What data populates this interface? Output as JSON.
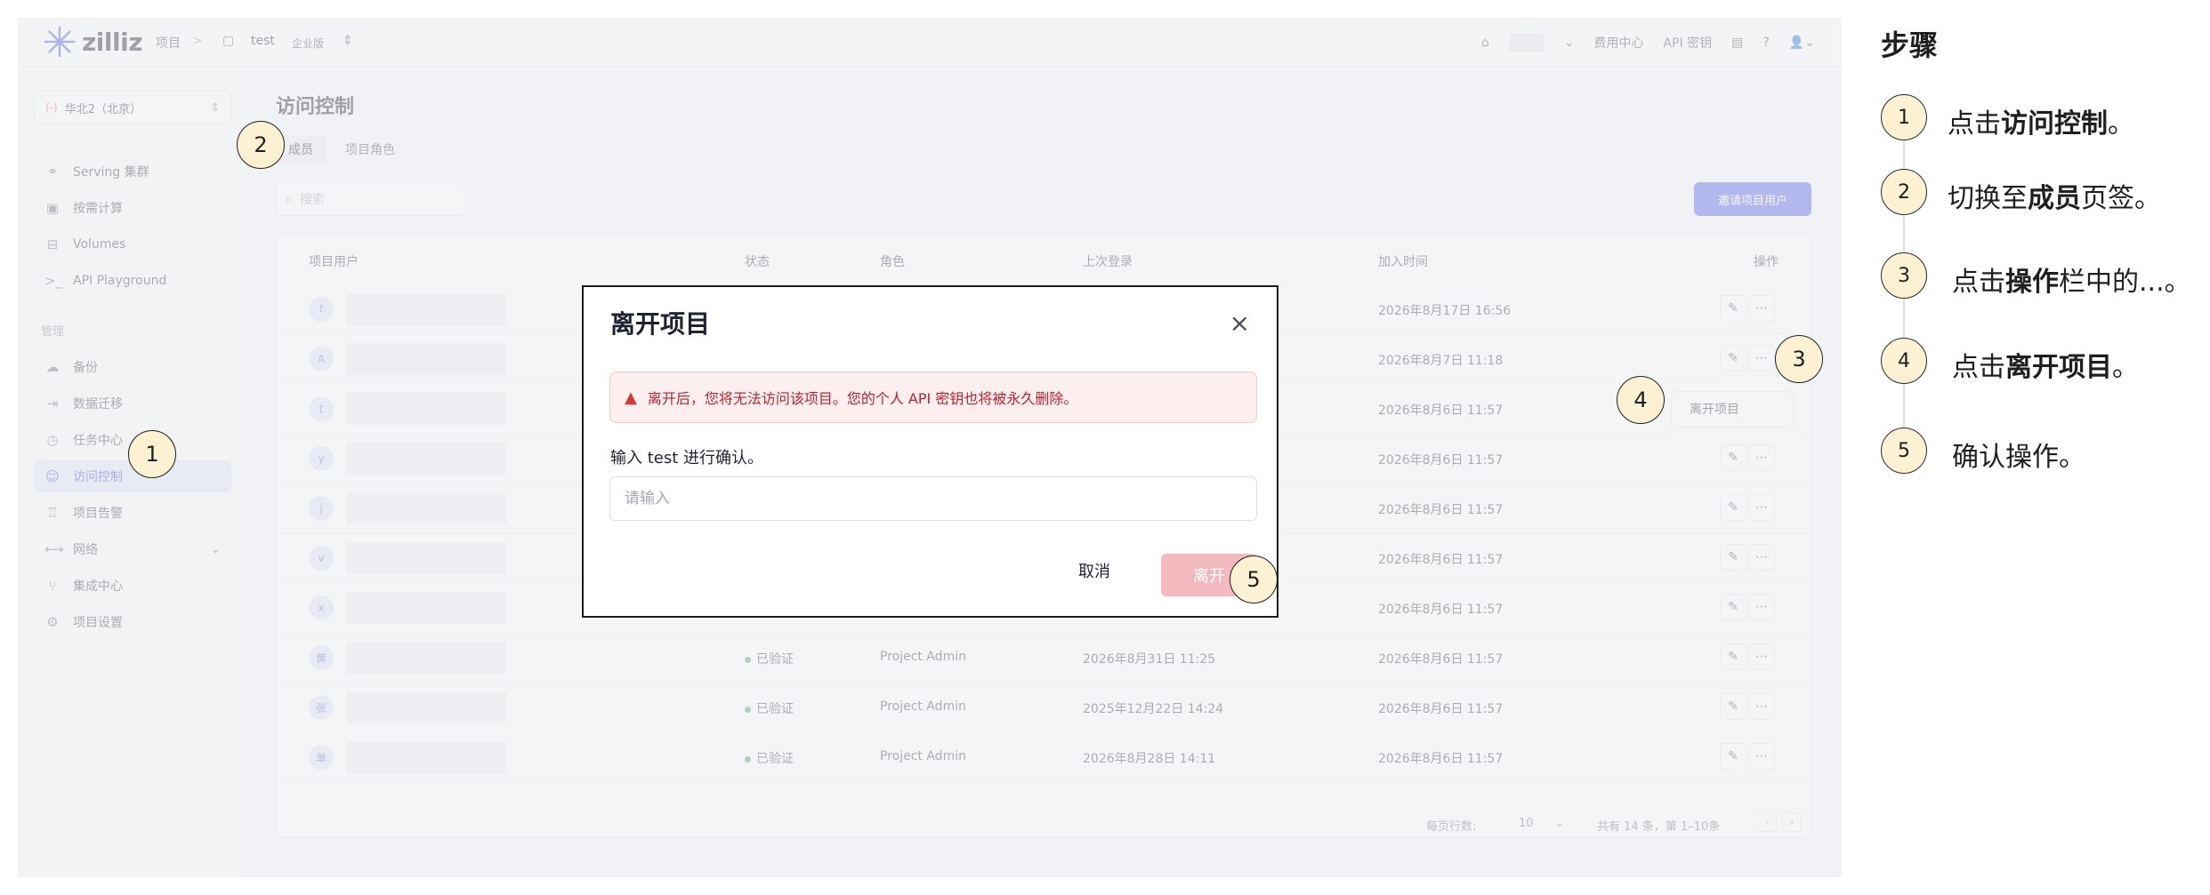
{
  "topbar": {
    "logo": "zilliz",
    "crumb_project": "项目",
    "crumb_sep": ">",
    "project_name": "test",
    "plan": "企业版",
    "billing": "费用中心",
    "api_key": "API 密钥"
  },
  "sidebar": {
    "region": "华北2（北京）",
    "region_tag": "(-)",
    "items": [
      {
        "label": "Serving 集群",
        "icon": "cluster-icon"
      },
      {
        "label": "按需计算",
        "icon": "compute-icon"
      },
      {
        "label": "Volumes",
        "icon": "volume-icon"
      },
      {
        "label": "API Playground",
        "icon": "terminal-icon"
      }
    ],
    "section": "管理",
    "manage_items": [
      {
        "label": "备份",
        "icon": "backup-icon"
      },
      {
        "label": "数据迁移",
        "icon": "migration-icon"
      },
      {
        "label": "任务中心",
        "icon": "clock-icon"
      },
      {
        "label": "访问控制",
        "icon": "users-icon"
      },
      {
        "label": "项目告警",
        "icon": "alarm-icon"
      },
      {
        "label": "网络",
        "icon": "network-icon"
      },
      {
        "label": "集成中心",
        "icon": "integration-icon"
      },
      {
        "label": "项目设置",
        "icon": "settings-icon"
      }
    ]
  },
  "main": {
    "title": "访问控制",
    "tabs": [
      "成员",
      "项目角色"
    ],
    "search_placeholder": "搜索",
    "invite_button": "邀请项目用户",
    "columns": [
      "项目用户",
      "状态",
      "角色",
      "上次登录",
      "加入时间",
      "操作"
    ],
    "rows": [
      {
        "initial": "f",
        "status": "",
        "role": "",
        "last_login": "",
        "joined": "2026年8月17日 16:56"
      },
      {
        "initial": "A",
        "status": "",
        "role": "",
        "last_login": "",
        "joined": "2026年8月7日 11:18"
      },
      {
        "initial": "t",
        "status": "",
        "role": "",
        "last_login": "",
        "joined": "2026年8月6日 11:57"
      },
      {
        "initial": "y",
        "status": "",
        "role": "",
        "last_login": "",
        "joined": "2026年8月6日 11:57"
      },
      {
        "initial": "j",
        "status": "",
        "role": "",
        "last_login": "",
        "joined": "2026年8月6日 11:57"
      },
      {
        "initial": "v",
        "status": "",
        "role": "",
        "last_login": "",
        "joined": "2026年8月6日 11:57"
      },
      {
        "initial": "x",
        "status": "",
        "role": "",
        "last_login": "",
        "joined": "2026年8月6日 11:57"
      },
      {
        "initial": "黄",
        "status": "已验证",
        "role": "Project Admin",
        "last_login": "2026年8月31日 11:25",
        "joined": "2026年8月6日 11:57"
      },
      {
        "initial": "张",
        "status": "已验证",
        "role": "Project Admin",
        "last_login": "2025年12月22日 14:24",
        "joined": "2026年8月6日 11:57"
      },
      {
        "initial": "单",
        "status": "已验证",
        "role": "Project Admin",
        "last_login": "2026年8月28日 14:11",
        "joined": "2026年8月6日 11:57"
      }
    ],
    "dropdown_item": "离开项目",
    "rows_per_page_label": "每页行数:",
    "rows_per_page": "10",
    "total": "共有 14 条，第 1–10条"
  },
  "modal": {
    "title": "离开项目",
    "alert": "离开后，您将无法访问该项目。您的个人 API 密钥也将被永久删除。",
    "confirm_label": "输入 test 进行确认。",
    "input_placeholder": "请输入",
    "cancel": "取消",
    "leave": "离开"
  },
  "steps": {
    "title": "步骤",
    "items": [
      {
        "num": "1",
        "pre": "点击",
        "bold": "访问控制",
        "post": "。"
      },
      {
        "num": "2",
        "pre": "切换至",
        "bold": "成员",
        "post": "页签。"
      },
      {
        "num": "3",
        "pre": "点击",
        "bold": "操作",
        "post": "栏中的...。"
      },
      {
        "num": "4",
        "pre": "点击",
        "bold": "离开项目",
        "post": "。"
      },
      {
        "num": "5",
        "pre": "确认操作。",
        "bold": "",
        "post": ""
      }
    ]
  },
  "markers": [
    "1",
    "2",
    "3",
    "4",
    "5"
  ],
  "colors": {
    "accent": "#5662e8",
    "marker_fill": "#fcf1d2",
    "danger": "#b3262f"
  }
}
